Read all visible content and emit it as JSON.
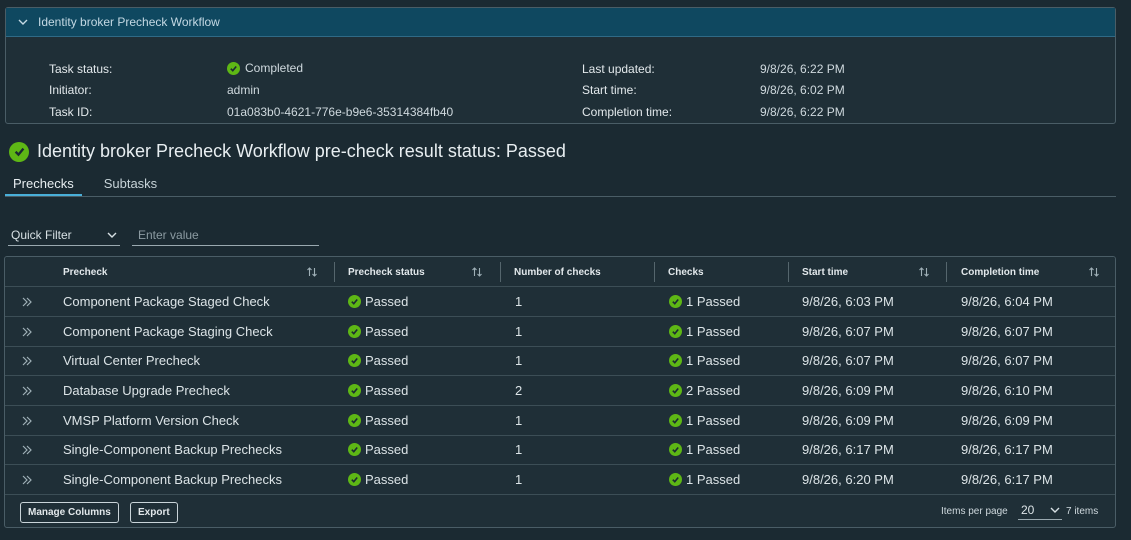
{
  "task_panel": {
    "title": "Identity broker Precheck Workflow",
    "labels": {
      "status": "Task status:",
      "initiator": "Initiator:",
      "task_id": "Task ID:",
      "last_updated": "Last updated:",
      "start_time": "Start time:",
      "completion_time": "Completion time:"
    },
    "values": {
      "status": "Completed",
      "initiator": "admin",
      "task_id": "01a083b0-4621-776e-b9e6-35314384fb40",
      "last_updated": "9/8/26, 6:22 PM",
      "start_time": "9/8/26, 6:02 PM",
      "completion_time": "9/8/26, 6:22 PM"
    }
  },
  "result_title": "Identity broker Precheck Workflow pre-check result status: Passed",
  "tabs": [
    {
      "label": "Prechecks",
      "active": true
    },
    {
      "label": "Subtasks",
      "active": false
    }
  ],
  "filter": {
    "quick_filter_label": "Quick Filter",
    "input_placeholder": "Enter value"
  },
  "grid": {
    "columns": {
      "precheck": "Precheck",
      "status": "Precheck status",
      "num_checks": "Number of checks",
      "checks": "Checks",
      "start": "Start time",
      "completion": "Completion time"
    },
    "rows": [
      {
        "name": "Component Package Staged Check",
        "status": "Passed",
        "num": "1",
        "checks": "1 Passed",
        "start": "9/8/26, 6:03 PM",
        "end": "9/8/26, 6:04 PM"
      },
      {
        "name": "Component Package Staging Check",
        "status": "Passed",
        "num": "1",
        "checks": "1 Passed",
        "start": "9/8/26, 6:07 PM",
        "end": "9/8/26, 6:07 PM"
      },
      {
        "name": "Virtual Center Precheck",
        "status": "Passed",
        "num": "1",
        "checks": "1 Passed",
        "start": "9/8/26, 6:07 PM",
        "end": "9/8/26, 6:07 PM"
      },
      {
        "name": "Database Upgrade Precheck",
        "status": "Passed",
        "num": "2",
        "checks": "2 Passed",
        "start": "9/8/26, 6:09 PM",
        "end": "9/8/26, 6:10 PM"
      },
      {
        "name": "VMSP Platform Version Check",
        "status": "Passed",
        "num": "1",
        "checks": "1 Passed",
        "start": "9/8/26, 6:09 PM",
        "end": "9/8/26, 6:09 PM"
      },
      {
        "name": "Single-Component Backup Prechecks",
        "status": "Passed",
        "num": "1",
        "checks": "1 Passed",
        "start": "9/8/26, 6:17 PM",
        "end": "9/8/26, 6:17 PM"
      },
      {
        "name": "Single-Component Backup Prechecks",
        "status": "Passed",
        "num": "1",
        "checks": "1 Passed",
        "start": "9/8/26, 6:20 PM",
        "end": "9/8/26, 6:17 PM"
      }
    ],
    "footer": {
      "manage_columns": "Manage Columns",
      "export": "Export",
      "items_per_page_label": "Items per page",
      "items_per_page_value": "20",
      "item_count": "7 items"
    }
  },
  "colors": {
    "background": "#1b2a32",
    "header_bar": "#0f4860",
    "success": "#5eb715",
    "tab_accent": "#49afd9"
  }
}
